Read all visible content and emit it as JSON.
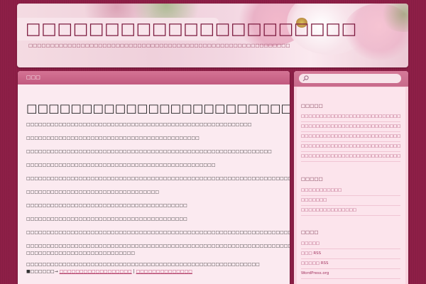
{
  "header": {
    "site_title": "□□□□□□□□□□□□□□□□□□□□□",
    "site_description": "□□□□□□□□□□□□□□□□□□□□□□□□□□□□□□□□□□□□□□□□□□□□□□□□□□□□□□□□□□□□"
  },
  "content": {
    "header_label": "□□□",
    "post_title": "□□□□□□□□□□□□□□□□□□□□□□□□□□",
    "paragraphs": [
      "□□□□□□□□□□□□□□□□□□□□□□□□□□□□□□□□□□□□□□□□□□□□□□□□□□□□□□□□",
      "□□□□□□□□□□□□□□□□□□□□□□□□□□□□□□□□□□□□□□□□□□□",
      "□□□□□□□□□□□□□□□□□□□□□□□□□□□□□□□□□□□□□□□□□□□□□□□□□□□□□□□□□□□□□",
      "□□□□□□□□□□□□□□□□□□□□□□□□□□□□□□□□□□□□□□□□□□□□□□□",
      "□□□□□□□□□□□□□□□□□□□□□□□□□□□□□□□□□□□□□□□□□□□□□□□□□□□□□□□□□□□□□□□□□□□□□□□□□□□□",
      "□□□□□□□□□□□□□□□□□□□□□□□□□□□□□□□□□",
      "□□□□□□□□□□□□□□□□□□□□□□□□□□□□□□□□□□□□□□□□",
      "□□□□□□□□□□□□□□□□□□□□□□□□□□□□□□□□□□□□□□□□",
      "□□□□□□□□□□□□□□□□□□□□□□□□□□□□□□□□□□□□□□□□□□□□□□□□□□□□□□□□□□□□□□□□□□□□□□□□□□□□",
      "□□□□□□□□□□□□□□□□□□□□□□□□□□□□□□□□□□□□□□□□□□□□□□□□□□□□□□□□□□□□□□□□□□□□□□□□□□□□□□□□□□",
      "□□□□□□□□□□□□□□□□□□□□□□□□□□□",
      "□□□□□□□□□□□□□□□□□□□□□□□□□□□□□□□□□□□□□□□□□□□□□□□□□□□□□□□□□□"
    ],
    "footer_prefix": "■□□□□□□→",
    "footer_link_1": "□□□□□□□□□□□□□□□□□□",
    "footer_separator": "|",
    "footer_link_2": "□□□□□□□□□□□□□□"
  },
  "sidebar": {
    "search_placeholder": "",
    "widgets": [
      {
        "title": "□□□□□",
        "items": [
          "□□□□□□□□□□□□□□□□□□□□□□□□□□□□□□□□□□□□□□□□",
          "□□□□□□□□□□□□□□□□□□□□□□□□□□□□□□□□□□□□□□",
          "□□□□□□□□□□□□□□□□□□□□□□□□□□□□□□□□□□□□□",
          "□□□□□□□□□□□□□□□□□□□□□□□□□□□□□□□□□□□□□□□□□",
          "□□□□□□□□□□□□□□□□□□□□□□□□□□□□□□□□□□□□□"
        ]
      },
      {
        "title": "□□□□□",
        "items": [
          "□□□□□□□□□□□",
          "□□□□□□□",
          "□□□□□□□□□□□□□□□"
        ]
      },
      {
        "title": "□□□□",
        "items": [
          "□□□□□",
          "□□□ RSS",
          "□□□□□ RSS",
          "WordPress.org"
        ]
      }
    ]
  },
  "colors": {
    "background": "#8e1f47",
    "content_header": "#cc6287",
    "sidebar": "#f9d3df",
    "link": "#b23c67"
  },
  "icons": {
    "search": "search-icon"
  }
}
